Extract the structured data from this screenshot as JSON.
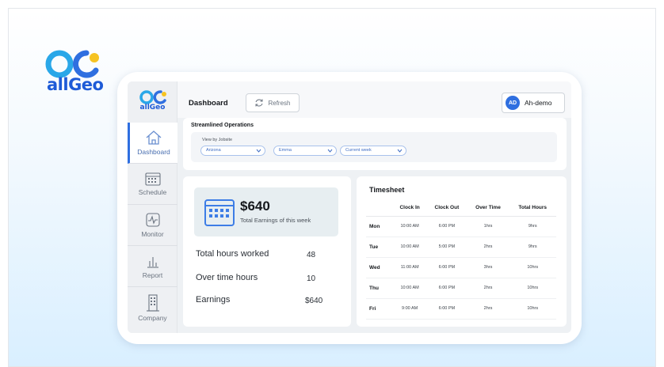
{
  "brand": {
    "name": "allGeo",
    "colors": {
      "blue": "#1e5bd7",
      "yellow": "#f6c322",
      "accent": "#2f6fe0"
    }
  },
  "sidebar": {
    "logo_text": "allGeo",
    "items": [
      {
        "label": "Dashboard",
        "icon": "home-icon",
        "active": true
      },
      {
        "label": "Schedule",
        "icon": "calendar-icon",
        "active": false
      },
      {
        "label": "Monitor",
        "icon": "pulse-icon",
        "active": false
      },
      {
        "label": "Report",
        "icon": "bar-chart-icon",
        "active": false
      },
      {
        "label": "Company",
        "icon": "building-icon",
        "active": false
      }
    ]
  },
  "header": {
    "title": "Dashboard",
    "refresh_label": "Refresh",
    "user": {
      "initials": "AD",
      "name": "Ah-demo"
    }
  },
  "filters": {
    "title": "Streamlined Operations",
    "view_by_label": "View by Jobsite",
    "jobsite": "Arizona",
    "employee": "Emma",
    "period": "Current week"
  },
  "earnings": {
    "amount": "$640",
    "subtitle": "Total Earnings of this week",
    "stats": [
      {
        "label": "Total hours worked",
        "value": "48"
      },
      {
        "label": "Over time hours",
        "value": "10"
      },
      {
        "label": "Earnings",
        "value": "$640"
      }
    ]
  },
  "timesheet": {
    "title": "Timesheet",
    "columns": [
      "",
      "Clock In",
      "Clock Out",
      "Over Time",
      "Total Hours"
    ],
    "rows": [
      {
        "day": "Mon",
        "in": "10:00 AM",
        "out": "6:00 PM",
        "ot": "1hrs",
        "total": "9hrs"
      },
      {
        "day": "Tue",
        "in": "10:00 AM",
        "out": "5:00 PM",
        "ot": "2hrs",
        "total": "9hrs"
      },
      {
        "day": "Wed",
        "in": "11:00 AM",
        "out": "6:00 PM",
        "ot": "3hrs",
        "total": "10hrs"
      },
      {
        "day": "Thu",
        "in": "10:00 AM",
        "out": "6:00 PM",
        "ot": "2hrs",
        "total": "10hrs"
      },
      {
        "day": "Fri",
        "in": "9:00 AM",
        "out": "6:00 PM",
        "ot": "2hrs",
        "total": "10hrs"
      }
    ]
  }
}
